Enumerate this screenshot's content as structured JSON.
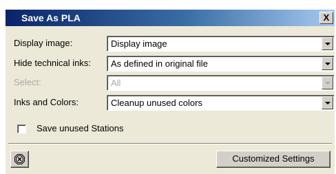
{
  "window": {
    "title": "Save As PLA",
    "close_label": "X"
  },
  "form": {
    "rows": [
      {
        "label": "Display image:",
        "value": "Display image",
        "enabled": true
      },
      {
        "label": "Hide technical inks:",
        "value": "As defined in original file",
        "enabled": true
      },
      {
        "label": "Select:",
        "value": "All",
        "enabled": false
      },
      {
        "label": "Inks and Colors:",
        "value": "Cleanup unused colors",
        "enabled": true
      }
    ],
    "save_unused_stations": {
      "label": "Save unused Stations",
      "checked": false
    }
  },
  "footer": {
    "customized_settings_label": "Customized Settings",
    "help_icon": "stop-sign-icon"
  },
  "colors": {
    "title_gradient_start": "#0a246a",
    "title_gradient_end": "#a6caf0",
    "dialog_background": "#ece9d8",
    "disabled_text": "#a9a9a9"
  }
}
